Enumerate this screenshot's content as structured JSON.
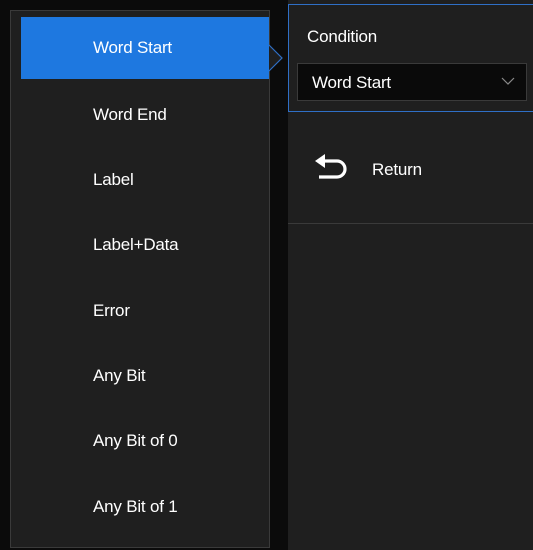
{
  "dropdown": {
    "items": [
      {
        "label": "Word Start",
        "selected": true
      },
      {
        "label": "Word End",
        "selected": false
      },
      {
        "label": "Label",
        "selected": false
      },
      {
        "label": "Label+Data",
        "selected": false
      },
      {
        "label": "Error",
        "selected": false
      },
      {
        "label": "Any Bit",
        "selected": false
      },
      {
        "label": "Any Bit of 0",
        "selected": false
      },
      {
        "label": "Any Bit of 1",
        "selected": false
      }
    ]
  },
  "menu": {
    "condition_label": "Condition",
    "condition_value": "Word Start",
    "return_label": "Return"
  },
  "colors": {
    "accent": "#1e78e0",
    "panel": "#1f1f1f",
    "background": "#0b0b0b",
    "border_highlight": "#2f6fc6"
  },
  "icons": {
    "pointer": "pointer-arrow-icon",
    "chevron": "chevron-down-icon",
    "return": "return-arrow-icon"
  }
}
